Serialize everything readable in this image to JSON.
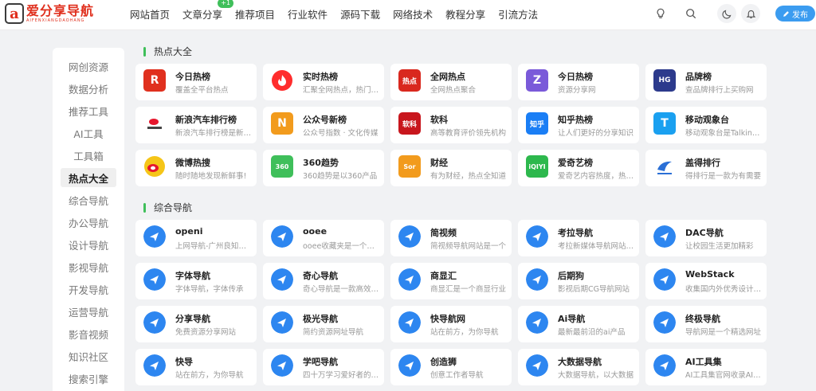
{
  "logo": {
    "mark": "a",
    "title": "爱分享导航",
    "subtitle": "AIFENXIANGDAOHANG"
  },
  "nav": [
    {
      "label": "网站首页"
    },
    {
      "label": "文章分享",
      "badge": "+1"
    },
    {
      "label": "推荐项目"
    },
    {
      "label": "行业软件"
    },
    {
      "label": "源码下载"
    },
    {
      "label": "网络技术"
    },
    {
      "label": "教程分享"
    },
    {
      "label": "引流方法"
    }
  ],
  "header": {
    "publish_label": "发布"
  },
  "sidebar": {
    "items": [
      "网创资源",
      "数据分析",
      "推荐工具",
      "AI工具",
      "工具箱",
      "热点大全",
      "综合导航",
      "办公导航",
      "设计导航",
      "影视导航",
      "开发导航",
      "运营导航",
      "影音视频",
      "知识社区",
      "搜索引擎"
    ],
    "active": "热点大全"
  },
  "sections": [
    {
      "title": "热点大全",
      "cards": [
        {
          "title": "今日热榜",
          "desc": "覆盖全平台热点",
          "icon": "R",
          "color": "#e0301e"
        },
        {
          "title": "实时热榜",
          "desc": "汇聚全网热点，热门头条",
          "icon": "flame-icon",
          "color": "#ff2d2d"
        },
        {
          "title": "全网热点",
          "desc": "全网热点聚合",
          "icon": "热点",
          "color": "#d9281e"
        },
        {
          "title": "今日热榜",
          "desc": "资源分享网",
          "icon": "Z",
          "color": "#7a5ad9"
        },
        {
          "title": "品牌榜",
          "desc": "查品牌排行上买购网",
          "icon": "HG",
          "color": "#2c3a8c"
        },
        {
          "title": "新浪汽车排行榜",
          "desc": "新浪汽车排行榜是新浪汽车",
          "icon": "sina-icon",
          "color": "#222222"
        },
        {
          "title": "公众号新榜",
          "desc": "公众号指数 · 文化传媒",
          "icon": "N",
          "color": "#f29b1d"
        },
        {
          "title": "软科",
          "desc": "高等教育评价领先机构",
          "icon": "软科",
          "color": "#c8161d"
        },
        {
          "title": "知乎热榜",
          "desc": "让人们更好的分享知识",
          "icon": "知乎",
          "color": "#1a7ef5"
        },
        {
          "title": "移动观象台",
          "desc": "移动观象台是Talkingdata",
          "icon": "T",
          "color": "#1aa0f0"
        },
        {
          "title": "微博热搜",
          "desc": "随时随地发现新鲜事!",
          "icon": "weibo-icon",
          "color": "#f5c518"
        },
        {
          "title": "360趋势",
          "desc": "360趋势是以360产品",
          "icon": "360",
          "color": "#3fbf5a"
        },
        {
          "title": "财经",
          "desc": "有为财经，热点全知道",
          "icon": "Sor",
          "color": "#f29b1d"
        },
        {
          "title": "爱奇艺榜",
          "desc": "爱奇艺内容热度，热播榜",
          "icon": "iQIYI",
          "color": "#2db84d"
        },
        {
          "title": "盖得排行",
          "desc": "得排行是一款为有需要",
          "icon": "gaide-icon",
          "color": "#2a6fd6"
        }
      ]
    },
    {
      "title": "综合导航",
      "cards": [
        {
          "title": "openi",
          "desc": "上网导航-广州良知科技"
        },
        {
          "title": "ooee",
          "desc": "ooee收藏夹是一个网址"
        },
        {
          "title": "简视频",
          "desc": "简视频导航网站是一个"
        },
        {
          "title": "考拉导航",
          "desc": "考拉新媒体导航网站是一个"
        },
        {
          "title": "DAC导航",
          "desc": "让校园生活更加精彩"
        },
        {
          "title": "字体导航",
          "desc": "字体导航，字体传承"
        },
        {
          "title": "奇心导航",
          "desc": "奇心导航是一款高效实用"
        },
        {
          "title": "商显汇",
          "desc": "商显汇是一个商显行业"
        },
        {
          "title": "后期狗",
          "desc": "影视后期CG导航网站"
        },
        {
          "title": "WebStack",
          "desc": "收集国内外优秀设计网站"
        },
        {
          "title": "分享导航",
          "desc": "免费资源分享网站"
        },
        {
          "title": "极光导航",
          "desc": "简约资源网址导航"
        },
        {
          "title": "快导航网",
          "desc": "站在前方，为你导航"
        },
        {
          "title": "Ai导航",
          "desc": "最新最前沿的ai产品"
        },
        {
          "title": "终极导航",
          "desc": "导航网是一个精选网址"
        },
        {
          "title": "快导",
          "desc": "站在前方，为你导航"
        },
        {
          "title": "学吧导航",
          "desc": "四十万学习爱好者的选择"
        },
        {
          "title": "创造狮",
          "desc": "创意工作者导航"
        },
        {
          "title": "大数据导航",
          "desc": "大数据导航，以大数据"
        },
        {
          "title": "AI工具集",
          "desc": "AI工具集官网收录AI工具"
        }
      ]
    }
  ]
}
